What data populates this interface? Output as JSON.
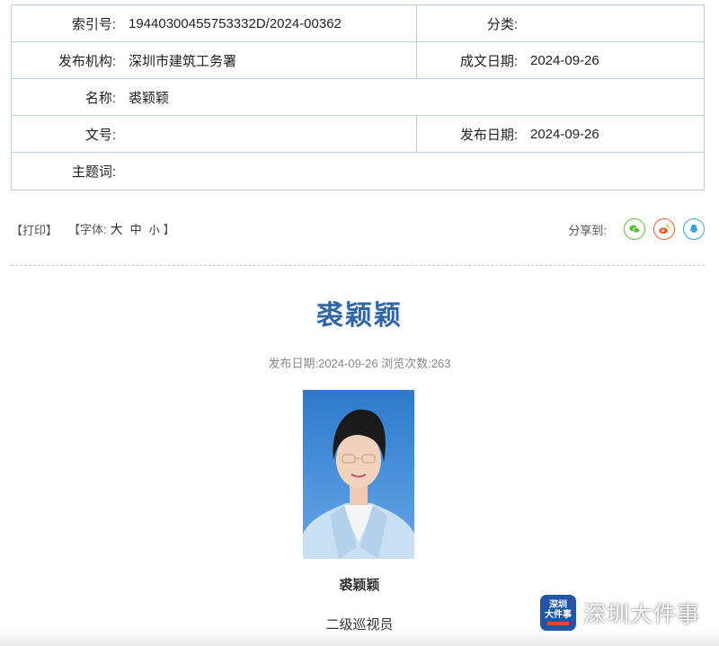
{
  "meta": {
    "index_label": "索引号:",
    "index_value": "19440300455753332D/2024-00362",
    "category_label": "分类:",
    "category_value": "",
    "publisher_label": "发布机构:",
    "publisher_value": "深圳市建筑工务署",
    "created_label": "成文日期:",
    "created_value": "2024-09-26",
    "name_label": "名称:",
    "name_value": "裘颖颖",
    "doc_no_label": "文号:",
    "doc_no_value": "",
    "publish_label": "发布日期:",
    "publish_value": "2024-09-26",
    "keywords_label": "主题词:",
    "keywords_value": ""
  },
  "toolbar": {
    "print_label": "【打印】",
    "font_prefix": "【字体:",
    "font_large": "大",
    "font_medium": "中",
    "font_small": "小",
    "font_suffix": "】",
    "share_label": "分享到:",
    "share_icons": [
      "wechat-icon",
      "weibo-icon",
      "qq-icon"
    ]
  },
  "article": {
    "title": "裘颖颖",
    "info": "发布日期:2024-09-26 浏览次数:263",
    "caption_name": "裘颖颖",
    "caption_title": "二级巡视员"
  },
  "watermark": {
    "logo_line1": "深圳",
    "logo_line2": "大件事",
    "text": "深圳大件事"
  },
  "colors": {
    "title_blue": "#2f66a8",
    "border_blue": "#b9cde3",
    "wechat_green": "#5bbf3a",
    "weibo_orange": "#e8602c",
    "qq_blue": "#3aa0e0"
  }
}
